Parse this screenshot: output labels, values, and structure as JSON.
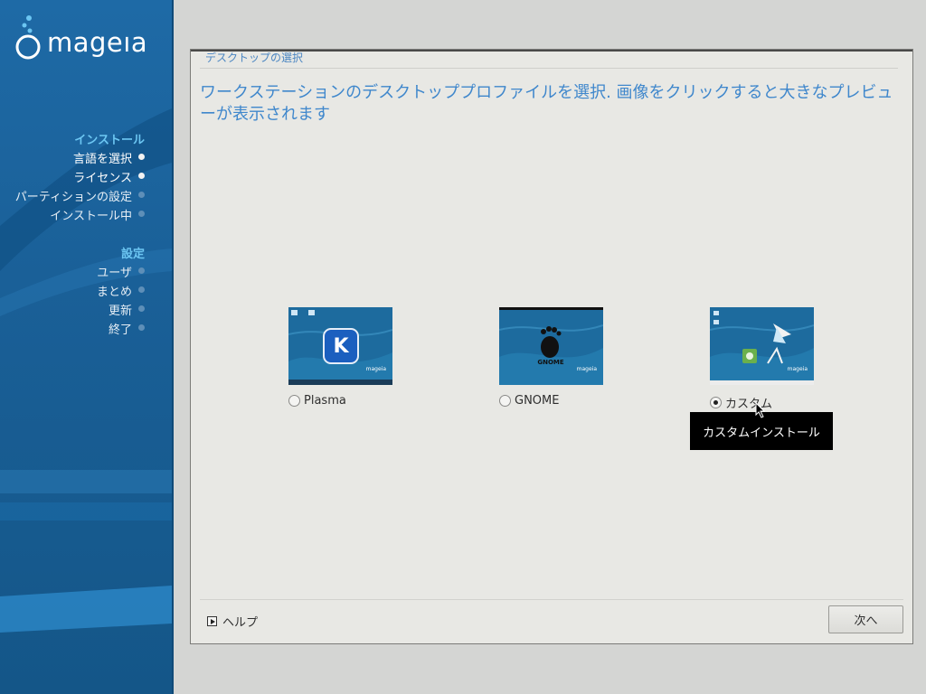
{
  "sidebar": {
    "brand": "mageıa",
    "sections": [
      {
        "title": "インストール",
        "steps": [
          {
            "label": "言語を選択",
            "state": "done"
          },
          {
            "label": "ライセンス",
            "state": "done"
          },
          {
            "label": "パーティションの設定",
            "state": "todo"
          },
          {
            "label": "インストール中",
            "state": "todo"
          }
        ]
      },
      {
        "title": "設定",
        "steps": [
          {
            "label": "ユーザ",
            "state": "todo"
          },
          {
            "label": "まとめ",
            "state": "todo"
          },
          {
            "label": "更新",
            "state": "todo"
          },
          {
            "label": "終了",
            "state": "todo"
          }
        ]
      }
    ]
  },
  "main": {
    "frame_title": "デスクトップの選択",
    "heading": "ワークステーションのデスクトッププロファイルを選択. 画像をクリックすると大きなプレビューが表示されます",
    "options": [
      {
        "label": "Plasma",
        "selected": false,
        "thumb_logo": "kde-logo-icon"
      },
      {
        "label": "GNOME",
        "selected": false,
        "thumb_logo": "gnome-foot-icon",
        "thumb_text": "GNOME"
      },
      {
        "label": "カスタム",
        "selected": true,
        "thumb_logo": "custom-desktop-icons"
      }
    ],
    "thumb_brand": "mageia",
    "tooltip": "カスタムインストール",
    "help_label": "ヘルプ",
    "next_label": "次へ"
  },
  "colors": {
    "sidebar_bg": "#1a6098",
    "section_title": "#6cc6f2",
    "heading_text": "#3f87cc",
    "window_bg": "#e8e8e4"
  }
}
